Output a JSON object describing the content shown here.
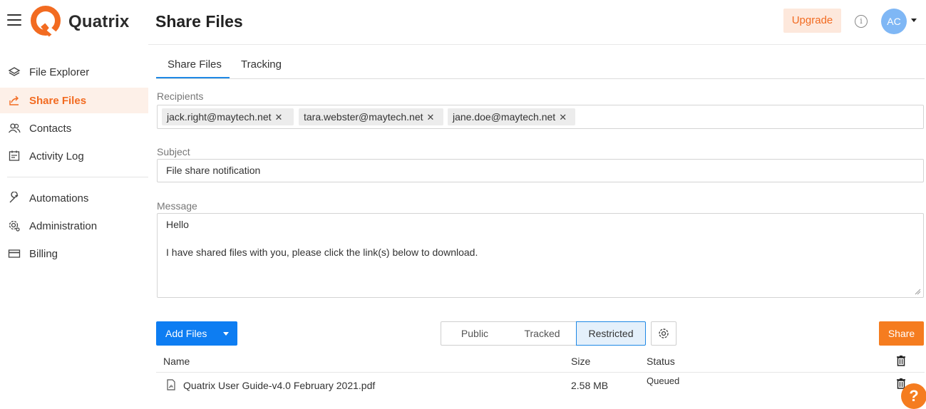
{
  "header": {
    "brand": "Quatrix",
    "page_title": "Share Files",
    "upgrade_label": "Upgrade",
    "info_icon": "info-icon",
    "avatar_initials": "AC"
  },
  "sidebar": {
    "items": [
      {
        "label": "File Explorer",
        "icon": "layers-icon"
      },
      {
        "label": "Share Files",
        "icon": "share-icon",
        "active": true
      },
      {
        "label": "Contacts",
        "icon": "contacts-icon"
      },
      {
        "label": "Activity Log",
        "icon": "activity-log-icon"
      },
      {
        "label": "Automations",
        "icon": "wrench-icon"
      },
      {
        "label": "Administration",
        "icon": "gear-icon"
      },
      {
        "label": "Billing",
        "icon": "card-icon"
      }
    ]
  },
  "tabs": [
    {
      "label": "Share Files",
      "active": true
    },
    {
      "label": "Tracking",
      "active": false
    }
  ],
  "form": {
    "recipients_label": "Recipients",
    "recipients": [
      "jack.right@maytech.net",
      "tara.webster@maytech.net",
      "jane.doe@maytech.net"
    ],
    "chip_remove": "✕",
    "subject_label": "Subject",
    "subject_value": "File share notification",
    "message_label": "Message",
    "message_line1": "Hello",
    "message_line2": "I have shared files with you, please click the link(s) below to download."
  },
  "actions": {
    "add_files_label": "Add Files",
    "access_options": [
      "Public",
      "Tracked",
      "Restricted"
    ],
    "selected_access": "Restricted",
    "share_label": "Share"
  },
  "table": {
    "columns": [
      "Name",
      "Size",
      "Status"
    ],
    "rows": [
      {
        "name": "Quatrix User Guide-v4.0 February 2021.pdf",
        "size": "2.58 MB",
        "status": "Queued"
      }
    ]
  },
  "help_label": "?",
  "colors": {
    "brand_orange": "#f26b21",
    "primary_blue": "#0d7df2",
    "active_bg": "#fdf0e8"
  }
}
